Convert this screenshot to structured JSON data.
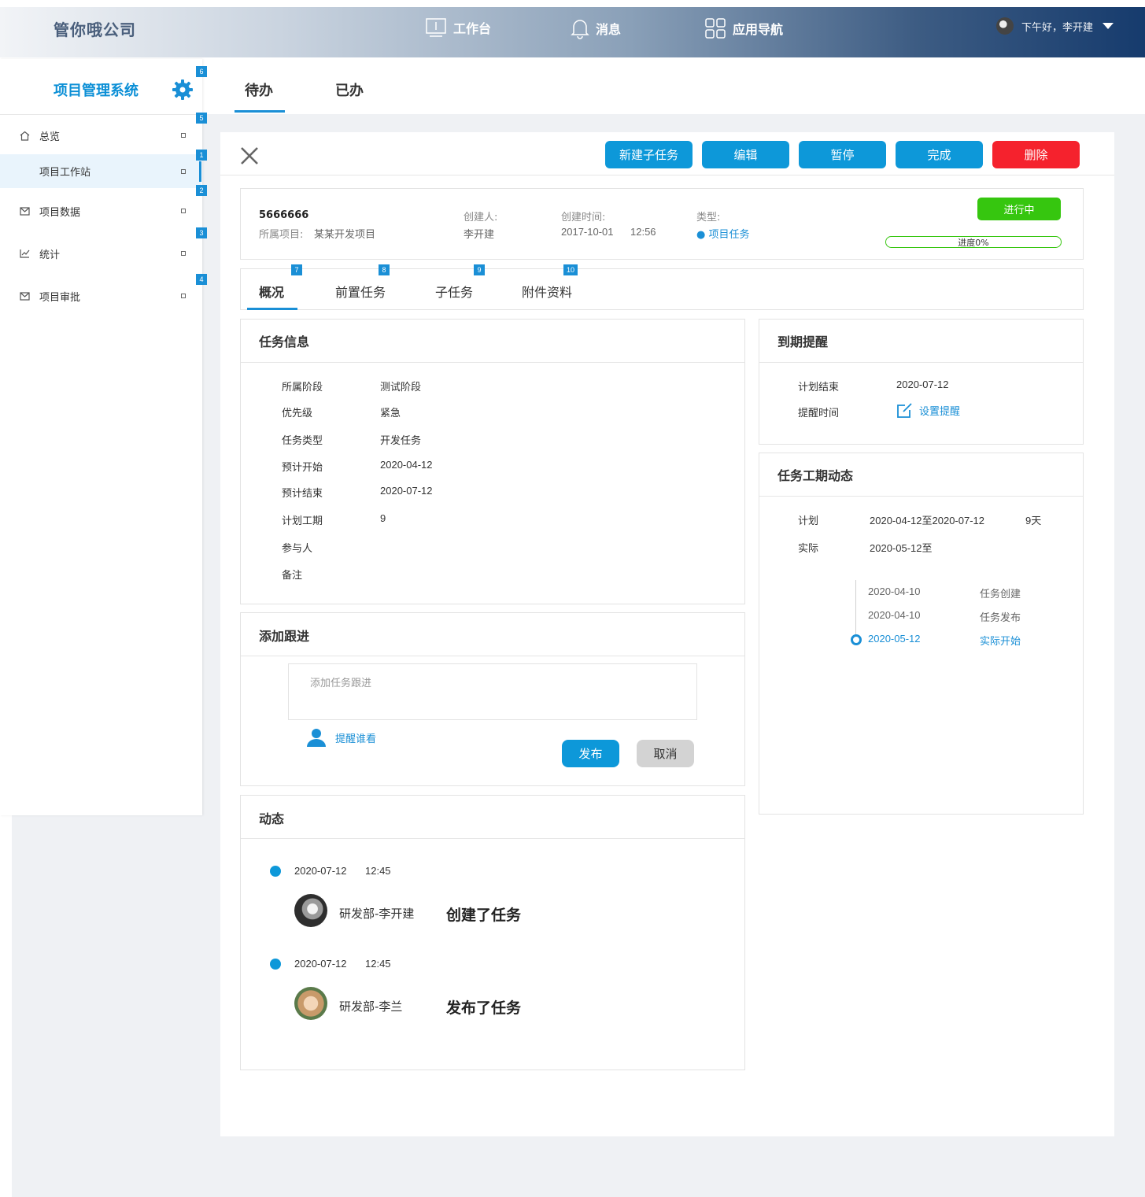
{
  "topbar": {
    "company": "管你哦公司",
    "nav": [
      {
        "label": "工作台",
        "icon": "monitor-icon"
      },
      {
        "label": "消息",
        "icon": "bell-icon"
      },
      {
        "label": "应用导航",
        "icon": "grid-icon"
      }
    ],
    "greeting": "下午好，李开建"
  },
  "sidebar": {
    "title": "项目管理系统",
    "items": [
      {
        "label": "总览",
        "icon": "home-icon",
        "badge": "5"
      },
      {
        "label": "项目工作站",
        "badge": "1"
      },
      {
        "label": "项目数据",
        "icon": "mail-icon",
        "badge": "2"
      },
      {
        "label": "统计",
        "icon": "chart-line-icon",
        "badge": "3"
      },
      {
        "label": "项目审批",
        "icon": "mail-icon",
        "badge": "4"
      }
    ],
    "gear_badge": "6"
  },
  "tabs": {
    "todo": "待办",
    "done": "已办"
  },
  "actions": {
    "new_subtask": "新建子任务",
    "edit": "编辑",
    "pause": "暂停",
    "complete": "完成",
    "delete": "删除"
  },
  "task": {
    "id": "5666666",
    "project_label": "所属项目:",
    "project": "某某开发项目",
    "creator_label": "创建人:",
    "creator": "李开建",
    "created_label": "创建时间:",
    "created_date": "2017-10-01",
    "created_time": "12:56",
    "type_label": "类型:",
    "type": "● 项目任务",
    "status": "进行中",
    "progress_text": "进度0%",
    "progress": 0
  },
  "subtabs": [
    {
      "label": "概况",
      "badge": "7"
    },
    {
      "label": "前置任务",
      "badge": "8"
    },
    {
      "label": "子任务",
      "badge": "9"
    },
    {
      "label": "附件资料",
      "badge": "10"
    }
  ],
  "task_info": {
    "title": "任务信息",
    "rows": [
      {
        "k": "所属阶段",
        "v": "测试阶段"
      },
      {
        "k": "优先级",
        "v": "紧急"
      },
      {
        "k": "任务类型",
        "v": "开发任务"
      },
      {
        "k": "预计开始",
        "v": "2020-04-12"
      },
      {
        "k": "预计结束",
        "v": "2020-07-12"
      },
      {
        "k": "计划工期",
        "v": "9"
      },
      {
        "k": "参与人",
        "v": ""
      },
      {
        "k": "备注",
        "v": ""
      }
    ]
  },
  "reminder": {
    "title": "到期提醒",
    "plan_end_label": "计划结束",
    "plan_end": "2020-07-12",
    "remind_label": "提醒时间",
    "set_remind": "设置提醒"
  },
  "duration": {
    "title": "任务工期动态",
    "plan_label": "计划",
    "plan": "2020-04-12至2020-07-12",
    "plan_days": "9天",
    "actual_label": "实际",
    "actual": "2020-05-12至",
    "timeline": [
      {
        "date": "2020-04-10",
        "event": "任务创建"
      },
      {
        "date": "2020-04-10",
        "event": "任务发布"
      },
      {
        "date": "2020-05-12",
        "event": "实际开始"
      }
    ]
  },
  "follow": {
    "title": "添加跟进",
    "placeholder": "添加任务跟进",
    "remind": "提醒谁看",
    "publish": "发布",
    "cancel": "取消"
  },
  "activity": {
    "title": "动态",
    "items": [
      {
        "date": "2020-07-12",
        "time": "12:45",
        "user": "研发部-李开建",
        "action": "创建了任务"
      },
      {
        "date": "2020-07-12",
        "time": "12:45",
        "user": "研发部-李兰",
        "action": "发布了任务"
      }
    ]
  },
  "colors": {
    "accent": "#0d98d9",
    "danger": "#f5222d",
    "success": "#36c60f"
  }
}
